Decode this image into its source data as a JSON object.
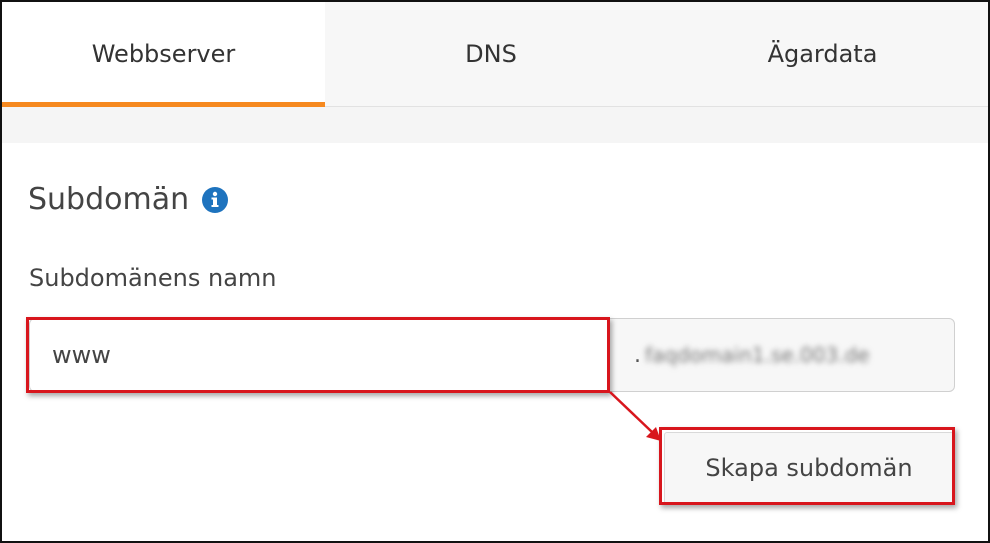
{
  "tabs": [
    {
      "label": "Webbserver",
      "active": true
    },
    {
      "label": "DNS",
      "active": false
    },
    {
      "label": "Ägardata",
      "active": false
    }
  ],
  "section": {
    "title": "Subdomän",
    "info_icon": "info-circle-icon"
  },
  "form": {
    "field_label": "Subdomänens namn",
    "subdomain_value": "www",
    "suffix_dot": ".",
    "suffix_domain": "faqdomain1.se.003.de",
    "create_button_label": "Skapa subdomän"
  },
  "colors": {
    "tab_active_underline": "#f6891f",
    "info_icon": "#1e73be",
    "highlight": "#d8161d"
  }
}
